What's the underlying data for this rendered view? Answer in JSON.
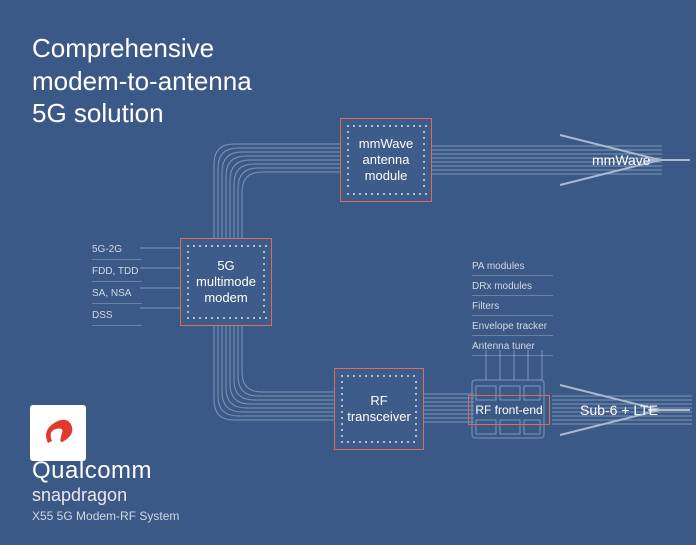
{
  "title": {
    "line1": "Comprehensive",
    "line2": "modem-to-antenna",
    "line3": "5G solution"
  },
  "chips": {
    "modem": "5G\nmultimode\nmodem",
    "mmwave_module": "mmWave\nantenna\nmodule",
    "rf_transceiver": "RF\ntransceiver",
    "rf_front_end": "RF front-end"
  },
  "left_labels": [
    "5G-2G",
    "FDD, TDD",
    "SA, NSA",
    "DSS"
  ],
  "fe_labels": [
    "PA modules",
    "DRx modules",
    "Filters",
    "Envelope tracker",
    "Antenna tuner"
  ],
  "outputs": {
    "mmwave": "mmWave",
    "sub6": "Sub-6 + LTE"
  },
  "brand": {
    "company": "Qualcomm",
    "product": "snapdragon",
    "sub": "X55 5G Modem-RF System"
  }
}
